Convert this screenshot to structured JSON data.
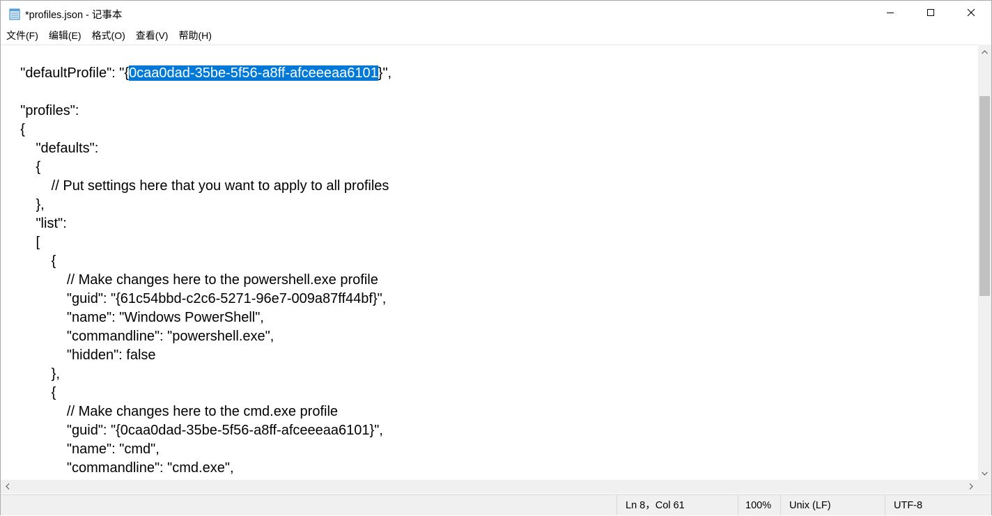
{
  "window": {
    "title": "*profiles.json - 记事本",
    "icon": "notepad-icon",
    "controls": {
      "minimize": "minimize-icon",
      "maximize": "maximize-icon",
      "close": "close-icon"
    }
  },
  "menubar": {
    "items": [
      {
        "label": "文件(F)"
      },
      {
        "label": "编辑(E)"
      },
      {
        "label": "格式(O)"
      },
      {
        "label": "查看(V)"
      },
      {
        "label": "帮助(H)"
      }
    ]
  },
  "editor": {
    "selected_text": "0caa0dad-35be-5f56-a8ff-afceeeaa6101",
    "lines": [
      {
        "before": "    \"defaultProfile\": \"{",
        "selected": "0caa0dad-35be-5f56-a8ff-afceeeaa6101",
        "after": "}\","
      },
      {
        "before": ""
      },
      {
        "before": "    \"profiles\":"
      },
      {
        "before": "    {"
      },
      {
        "before": "        \"defaults\":"
      },
      {
        "before": "        {"
      },
      {
        "before": "            // Put settings here that you want to apply to all profiles"
      },
      {
        "before": "        },"
      },
      {
        "before": "        \"list\":"
      },
      {
        "before": "        ["
      },
      {
        "before": "            {"
      },
      {
        "before": "                // Make changes here to the powershell.exe profile"
      },
      {
        "before": "                \"guid\": \"{61c54bbd-c2c6-5271-96e7-009a87ff44bf}\","
      },
      {
        "before": "                \"name\": \"Windows PowerShell\","
      },
      {
        "before": "                \"commandline\": \"powershell.exe\","
      },
      {
        "before": "                \"hidden\": false"
      },
      {
        "before": "            },"
      },
      {
        "before": "            {"
      },
      {
        "before": "                // Make changes here to the cmd.exe profile"
      },
      {
        "before": "                \"guid\": \"{0caa0dad-35be-5f56-a8ff-afceeeaa6101}\","
      },
      {
        "before": "                \"name\": \"cmd\","
      },
      {
        "before": "                \"commandline\": \"cmd.exe\","
      }
    ]
  },
  "scrollbars": {
    "vertical_position": 0.18,
    "vertical_visible_fraction": 0.49
  },
  "statusbar": {
    "position": "Ln 8，Col 61",
    "zoom": "100%",
    "line_ending": "Unix (LF)",
    "encoding": "UTF-8"
  },
  "colors": {
    "selection": "#0078d7",
    "statusbar_bg": "#f0f0f0",
    "scrollbar_thumb": "#c1c1c1"
  }
}
